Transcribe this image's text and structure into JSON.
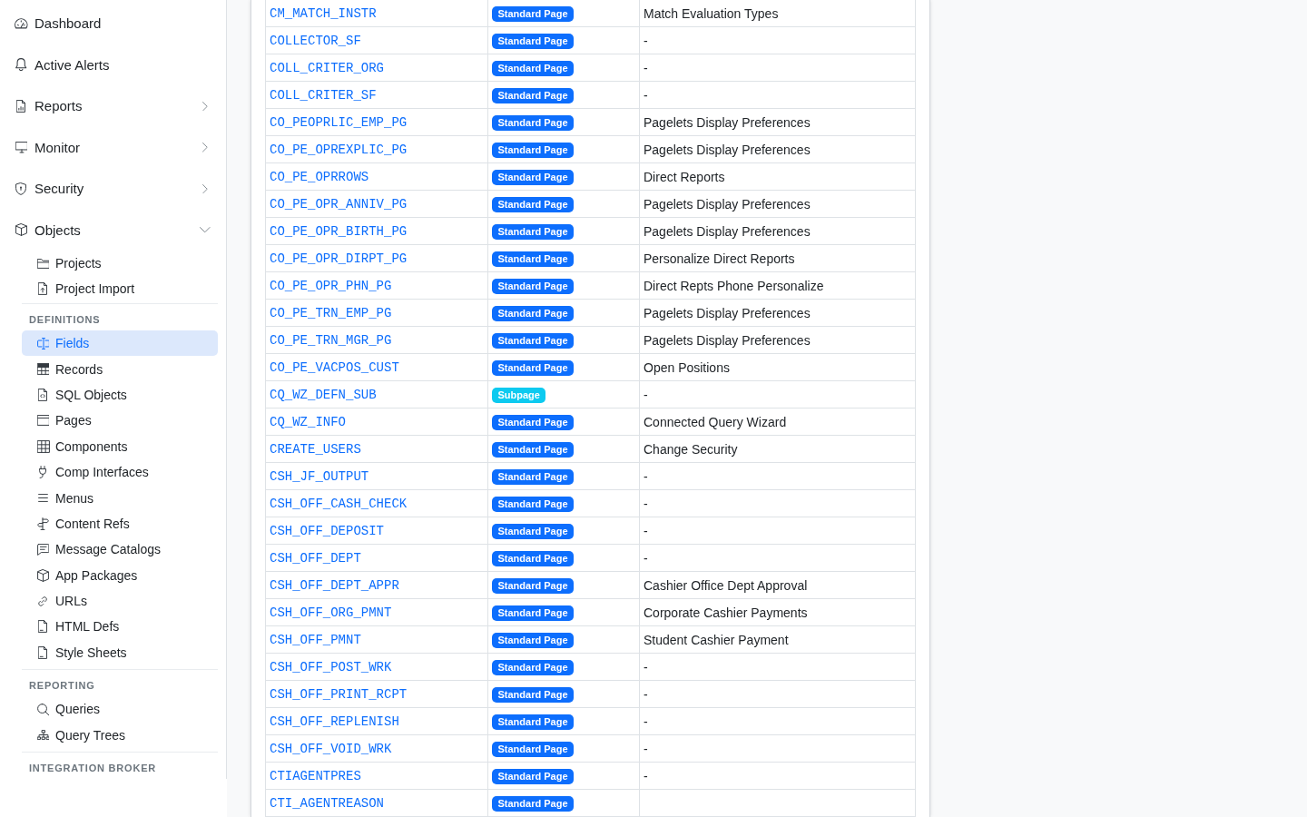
{
  "sidebar": {
    "items": [
      {
        "label": "Dashboard",
        "selected": false
      },
      {
        "label": "Active Alerts",
        "selected": false
      },
      {
        "label": "Reports",
        "selected": false,
        "expanded": false
      },
      {
        "label": "Monitor",
        "selected": false,
        "expanded": false
      },
      {
        "label": "Security",
        "selected": false,
        "expanded": false
      },
      {
        "label": "Objects",
        "selected": false,
        "expanded": true,
        "children": [
          {
            "label": "Projects",
            "selected": false
          },
          {
            "label": "Project Import",
            "selected": false
          }
        ]
      }
    ],
    "sections": [
      {
        "heading": "DEFINITIONS",
        "items": [
          {
            "label": "Fields",
            "selected": true
          },
          {
            "label": "Records",
            "selected": false
          },
          {
            "label": "SQL Objects",
            "selected": false
          },
          {
            "label": "Pages",
            "selected": false
          },
          {
            "label": "Components",
            "selected": false
          },
          {
            "label": "Comp Interfaces",
            "selected": false
          },
          {
            "label": "Menus",
            "selected": false
          },
          {
            "label": "Content Refs",
            "selected": false
          },
          {
            "label": "Message Catalogs",
            "selected": false
          },
          {
            "label": "App Packages",
            "selected": false
          },
          {
            "label": "URLs",
            "selected": false
          },
          {
            "label": "HTML Defs",
            "selected": false
          },
          {
            "label": "Style Sheets",
            "selected": false
          }
        ]
      },
      {
        "heading": "REPORTING",
        "items": [
          {
            "label": "Queries",
            "selected": false
          },
          {
            "label": "Query Trees",
            "selected": false
          }
        ]
      },
      {
        "heading": "INTEGRATION BROKER"
      }
    ]
  },
  "table": {
    "rows": [
      {
        "column_1": "CM_MATCH_INSTR",
        "column_2": {
          "label": "Standard Page",
          "color": "#0d6efd"
        },
        "column_3": "Match Evaluation Types"
      },
      {
        "column_1": "COLLECTOR_SF",
        "column_2": {
          "label": "Standard Page",
          "color": "#0d6efd"
        },
        "column_3": "-"
      },
      {
        "column_1": "COLL_CRITER_ORG",
        "column_2": {
          "label": "Standard Page",
          "color": "#0d6efd"
        },
        "column_3": "-"
      },
      {
        "column_1": "COLL_CRITER_SF",
        "column_2": {
          "label": "Standard Page",
          "color": "#0d6efd"
        },
        "column_3": "-"
      },
      {
        "column_1": "CO_PEOPRLIC_EMP_PG",
        "column_2": {
          "label": "Standard Page",
          "color": "#0d6efd"
        },
        "column_3": "Pagelets Display Preferences"
      },
      {
        "column_1": "CO_PE_OPREXPLIC_PG",
        "column_2": {
          "label": "Standard Page",
          "color": "#0d6efd"
        },
        "column_3": "Pagelets Display Preferences"
      },
      {
        "column_1": "CO_PE_OPRROWS",
        "column_2": {
          "label": "Standard Page",
          "color": "#0d6efd"
        },
        "column_3": "Direct Reports"
      },
      {
        "column_1": "CO_PE_OPR_ANNIV_PG",
        "column_2": {
          "label": "Standard Page",
          "color": "#0d6efd"
        },
        "column_3": "Pagelets Display Preferences"
      },
      {
        "column_1": "CO_PE_OPR_BIRTH_PG",
        "column_2": {
          "label": "Standard Page",
          "color": "#0d6efd"
        },
        "column_3": "Pagelets Display Preferences"
      },
      {
        "column_1": "CO_PE_OPR_DIRPT_PG",
        "column_2": {
          "label": "Standard Page",
          "color": "#0d6efd"
        },
        "column_3": "Personalize Direct Reports"
      },
      {
        "column_1": "CO_PE_OPR_PHN_PG",
        "column_2": {
          "label": "Standard Page",
          "color": "#0d6efd"
        },
        "column_3": "Direct Repts Phone Personalize"
      },
      {
        "column_1": "CO_PE_TRN_EMP_PG",
        "column_2": {
          "label": "Standard Page",
          "color": "#0d6efd"
        },
        "column_3": "Pagelets Display Preferences"
      },
      {
        "column_1": "CO_PE_TRN_MGR_PG",
        "column_2": {
          "label": "Standard Page",
          "color": "#0d6efd"
        },
        "column_3": "Pagelets Display Preferences"
      },
      {
        "column_1": "CO_PE_VACPOS_CUST",
        "column_2": {
          "label": "Standard Page",
          "color": "#0d6efd"
        },
        "column_3": "Open Positions"
      },
      {
        "column_1": "CQ_WZ_DEFN_SUB",
        "column_2": {
          "label": "Subpage",
          "color": "#0dcaf0"
        },
        "column_3": "-"
      },
      {
        "column_1": "CQ_WZ_INFO",
        "column_2": {
          "label": "Standard Page",
          "color": "#0d6efd"
        },
        "column_3": "Connected Query Wizard"
      },
      {
        "column_1": "CREATE_USERS",
        "column_2": {
          "label": "Standard Page",
          "color": "#0d6efd"
        },
        "column_3": "Change Security"
      },
      {
        "column_1": "CSH_JF_OUTPUT",
        "column_2": {
          "label": "Standard Page",
          "color": "#0d6efd"
        },
        "column_3": "-"
      },
      {
        "column_1": "CSH_OFF_CASH_CHECK",
        "column_2": {
          "label": "Standard Page",
          "color": "#0d6efd"
        },
        "column_3": "-"
      },
      {
        "column_1": "CSH_OFF_DEPOSIT",
        "column_2": {
          "label": "Standard Page",
          "color": "#0d6efd"
        },
        "column_3": "-"
      },
      {
        "column_1": "CSH_OFF_DEPT",
        "column_2": {
          "label": "Standard Page",
          "color": "#0d6efd"
        },
        "column_3": "-"
      },
      {
        "column_1": "CSH_OFF_DEPT_APPR",
        "column_2": {
          "label": "Standard Page",
          "color": "#0d6efd"
        },
        "column_3": "Cashier Office Dept Approval"
      },
      {
        "column_1": "CSH_OFF_ORG_PMNT",
        "column_2": {
          "label": "Standard Page",
          "color": "#0d6efd"
        },
        "column_3": "Corporate Cashier Payments"
      },
      {
        "column_1": "CSH_OFF_PMNT",
        "column_2": {
          "label": "Standard Page",
          "color": "#0d6efd"
        },
        "column_3": "Student Cashier Payment"
      },
      {
        "column_1": "CSH_OFF_POST_WRK",
        "column_2": {
          "label": "Standard Page",
          "color": "#0d6efd"
        },
        "column_3": "-"
      },
      {
        "column_1": "CSH_OFF_PRINT_RCPT",
        "column_2": {
          "label": "Standard Page",
          "color": "#0d6efd"
        },
        "column_3": "-"
      },
      {
        "column_1": "CSH_OFF_REPLENISH",
        "column_2": {
          "label": "Standard Page",
          "color": "#0d6efd"
        },
        "column_3": "-"
      },
      {
        "column_1": "CSH_OFF_VOID_WRK",
        "column_2": {
          "label": "Standard Page",
          "color": "#0d6efd"
        },
        "column_3": "-"
      },
      {
        "column_1": "CTIAGENTPRES",
        "column_2": {
          "label": "Standard Page",
          "color": "#0d6efd"
        },
        "column_3": "-"
      },
      {
        "column_1": "CTI_AGENTREASON",
        "column_2": {
          "label": "Standard Page",
          "color": "#0d6efd"
        }
      }
    ]
  }
}
